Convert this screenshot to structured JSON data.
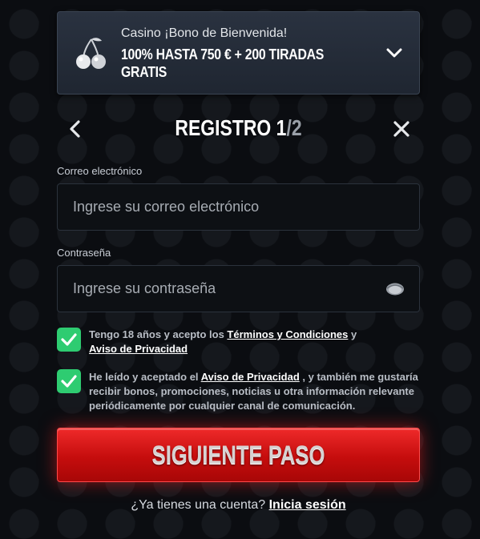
{
  "promo": {
    "subtitle": "Casino ¡Bono de Bienvenida!",
    "title": "100% HASTA 750 € + 200 TIRADAS GRATIS",
    "icon": "cherry-icon",
    "toggle_icon": "chevron-down-icon"
  },
  "header": {
    "title_main": "REGISTRO 1",
    "title_sep": "/",
    "title_total": "2",
    "back_icon": "chevron-left-icon",
    "close_icon": "close-icon"
  },
  "email": {
    "label": "Correo electrónico",
    "placeholder": "Ingrese su correo electrónico",
    "value": ""
  },
  "password": {
    "label": "Contraseña",
    "placeholder": "Ingrese su contraseña",
    "value": "",
    "toggle_icon": "eye-icon"
  },
  "consent_terms": {
    "checked": true,
    "text_before": "Tengo 18 años y acepto los ",
    "link_terms": "Términos y Condiciones",
    "text_mid": " y",
    "link_privacy": "Aviso de Privacidad"
  },
  "consent_marketing": {
    "checked": true,
    "text_before": "He leído y aceptado el ",
    "link_privacy": "Aviso de Privacidad",
    "text_after": " , y también me gustaría recibir bonos, promociones, noticias u otra información relevante periódicamente por cualquier canal de comunicación."
  },
  "cta": {
    "label": "SIGUIENTE PASO"
  },
  "footer": {
    "question": "¿Ya tienes una cuenta? ",
    "link": "Inicia sesión"
  },
  "colors": {
    "accent_red": "#c50d0d",
    "check_green": "#2ecc71",
    "background": "#0b0d11",
    "promo_panel": "#252c38"
  }
}
